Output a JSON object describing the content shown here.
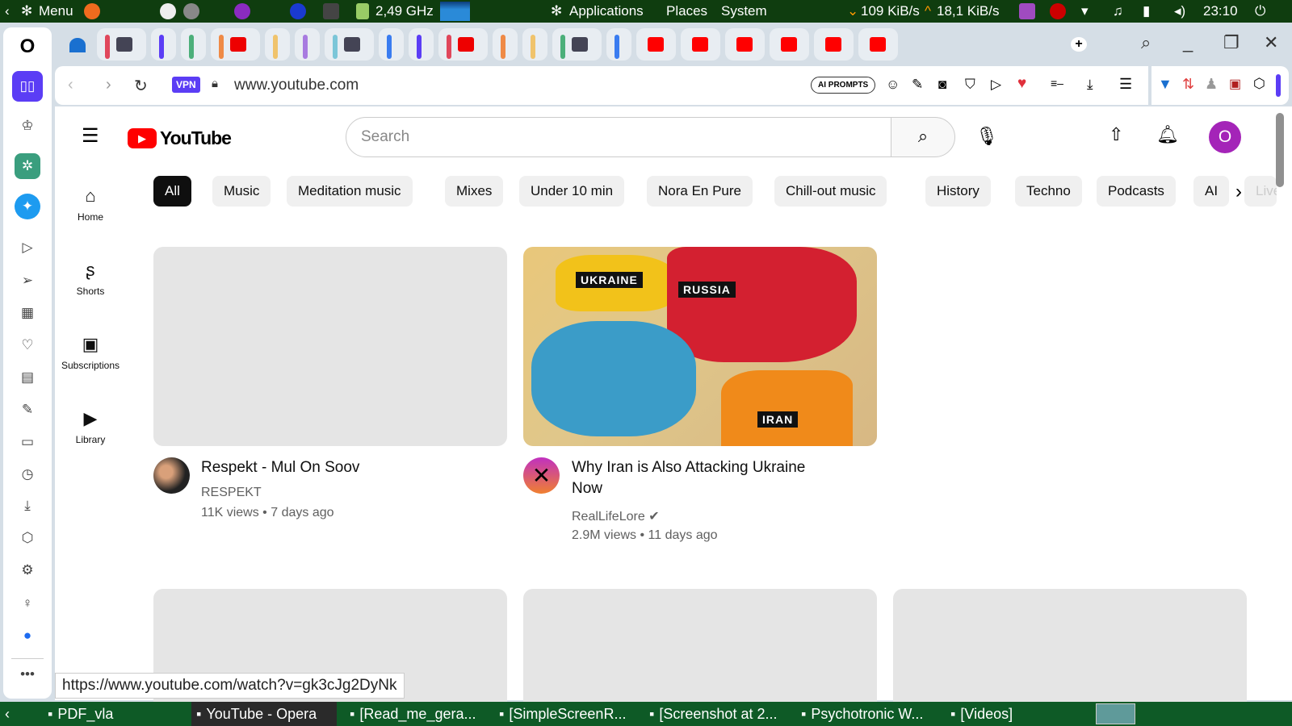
{
  "system_bar": {
    "menu": "Menu",
    "cpu": "2,49 GHz",
    "applications": "Applications",
    "places": "Places",
    "system": "System",
    "net_down": "109 KiB/s",
    "net_up": "18,1 KiB/s",
    "clock": "23:10"
  },
  "tab_group_colors": [
    "#e0475b",
    "#5b3df5",
    "#4caf7a",
    "#ef8a46",
    "#f0c36c",
    "#a87be0",
    "#7cc6d8",
    "#3a7cf0",
    "#5b3df5",
    "#e0475b",
    "#ef8a46",
    "#f0c36c",
    "#4caf7a",
    "#3a7cf0"
  ],
  "browser": {
    "vpn": "VPN",
    "url": "www.youtube.com",
    "ai_prompts": "AI PROMPTS",
    "accent": "#5b3df5"
  },
  "youtube": {
    "logo": "YouTube",
    "search_placeholder": "Search",
    "avatar_letter": "O",
    "nav": [
      {
        "label": "Home",
        "icon": "home-icon"
      },
      {
        "label": "Shorts",
        "icon": "shorts-icon"
      },
      {
        "label": "Subscriptions",
        "icon": "subscriptions-icon"
      },
      {
        "label": "Library",
        "icon": "library-icon"
      }
    ],
    "chips": [
      "All",
      "Music",
      "Meditation music",
      "Mixes",
      "Under 10 min",
      "Nora En Pure",
      "Chill-out music",
      "History",
      "Techno",
      "Podcasts",
      "AI",
      "Live"
    ],
    "videos": [
      {
        "title": "Respekt - Mul On Soov",
        "channel": "RESPEKT",
        "meta": "11K views • 7 days ago",
        "verified": false
      },
      {
        "title": "Why Iran is Also Attacking Ukraine Now",
        "channel": "RealLifeLore",
        "meta": "2.9M views • 11 days ago",
        "verified": true,
        "thumb_labels": [
          "UKRAINE",
          "RUSSIA",
          "IRAN"
        ]
      }
    ]
  },
  "status_url": "https://www.youtube.com/watch?v=gk3cJg2DyNk",
  "taskbar": [
    "PDF_vla",
    "YouTube - Opera",
    "[Read_me_gera...",
    "[SimpleScreenR...",
    "[Screenshot at 2...",
    "Psychotronic W...",
    "[Videos]"
  ]
}
